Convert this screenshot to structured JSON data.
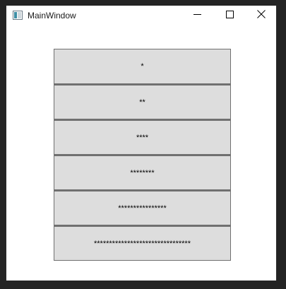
{
  "window": {
    "title": "MainWindow",
    "icon": "app-window-icon",
    "controls": {
      "minimize_icon": "minimize-icon",
      "maximize_icon": "maximize-icon",
      "close_icon": "close-icon"
    }
  },
  "buttons": [
    {
      "label": "*"
    },
    {
      "label": "**"
    },
    {
      "label": "****"
    },
    {
      "label": "********"
    },
    {
      "label": "****************"
    },
    {
      "label": "********************************"
    }
  ],
  "colors": {
    "button_fill": "#dddddd",
    "button_border": "#707070",
    "window_bg": "#ffffff",
    "desktop_bg": "#242424"
  }
}
